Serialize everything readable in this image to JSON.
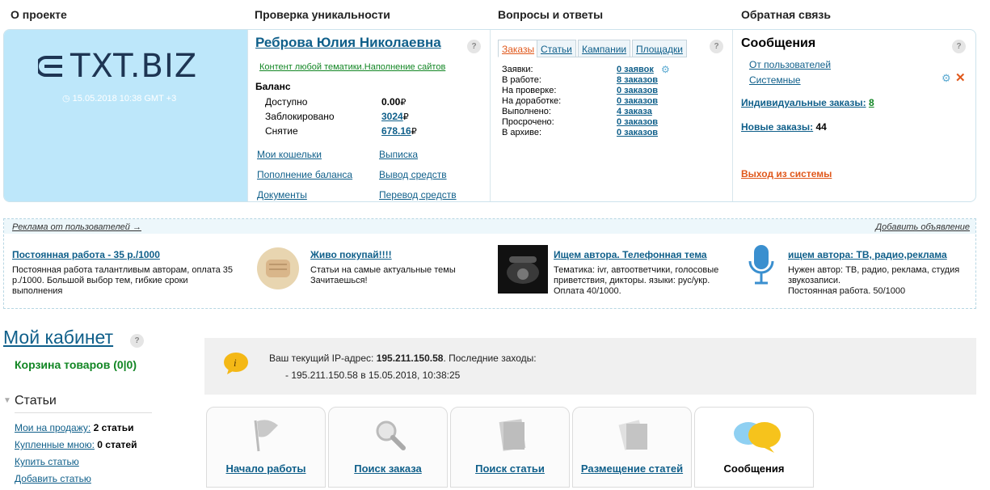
{
  "top_headings": [
    "О проекте",
    "Проверка уникальности",
    "Вопросы и ответы",
    "Обратная связь"
  ],
  "logo": {
    "text": "eTXT.BIZ",
    "datetime": "15.05.2018 10:38 GMT +3"
  },
  "profile": {
    "name": "Реброва Юлия Николаевна",
    "category": "Контент любой тематики.Наполнение сайтов",
    "balance_title": "Баланс",
    "balance": [
      {
        "label": "Доступно",
        "value": "0.00"
      },
      {
        "label": "Заблокировано",
        "value": "3024"
      },
      {
        "label": "Снятие",
        "value": "678.16"
      }
    ],
    "currency": "₽",
    "links": [
      "Мои кошельки",
      "Выписка",
      "Пополнение баланса",
      "Вывод средств",
      "Документы",
      "Перевод средств"
    ]
  },
  "orders": {
    "tabs": [
      "Заказы",
      "Статьи",
      "Кампании",
      "Площадки"
    ],
    "rows": [
      {
        "label": "Заявки:",
        "value": "0 заявок"
      },
      {
        "label": "В работе:",
        "value": "8 заказов"
      },
      {
        "label": "На проверке:",
        "value": "0 заказов"
      },
      {
        "label": "На доработке:",
        "value": "0 заказов"
      },
      {
        "label": "Выполнено:",
        "value": "4 заказа"
      },
      {
        "label": "Просрочено:",
        "value": "0 заказов"
      },
      {
        "label": "В архиве:",
        "value": "0 заказов"
      }
    ]
  },
  "messages": {
    "title": "Сообщения",
    "from_users": "От пользователей",
    "system": "Системные",
    "individual_label": "Индивидуальные заказы:",
    "individual_count": "8",
    "new_label": "Новые заказы:",
    "new_count": "44",
    "logout": "Выход из системы"
  },
  "ads": {
    "header_left": "Реклама от пользователей →",
    "header_right": "Добавить объявление",
    "items": [
      {
        "title": "Постоянная работа - 35 р./1000",
        "text": [
          "Постоянная работа талантливым авторам, оплата 35",
          "р./1000. Большой выбор тем, гибкие сроки",
          "выполнения"
        ]
      },
      {
        "title": "Живо покупай!!!!",
        "text": [
          "Статьи на самые актуальные темы",
          "Зачитаешься!"
        ]
      },
      {
        "title": "Ищем автора. Телефонная тема",
        "text": [
          "Тематика: ivr, автоответчики, голосовые",
          "приветствия, дикторы. языки: рус/укр.",
          "Оплата 40/1000."
        ]
      },
      {
        "title": "ищем автора: ТВ, радио,реклама",
        "text": [
          "Нужен автор: ТВ, радио, реклама, студия",
          "звукозаписи.",
          "Постоянная работа. 50/1000"
        ]
      }
    ]
  },
  "cabinet": {
    "title": "Мой кабинет",
    "cart": "Корзина товаров (0|0)",
    "section": "Статьи",
    "links": [
      {
        "label": "Мои на продажу:",
        "value": "2 статьи"
      },
      {
        "label": "Купленные мною:",
        "value": "0 статей"
      },
      {
        "label": "Купить статью",
        "value": ""
      },
      {
        "label": "Добавить статью",
        "value": ""
      }
    ]
  },
  "ipinfo": {
    "prefix": "Ваш текущий IP-адрес: ",
    "ip": "195.211.150.58",
    "suffix": ". Последние заходы:",
    "last": "- 195.211.150.58 в 15.05.2018, 10:38:25"
  },
  "cards": [
    "Начало работы",
    "Поиск заказа",
    "Поиск статьи",
    "Размещение статей",
    "Сообщения"
  ],
  "colors": {
    "link": "#0f5f8a",
    "green": "#128624",
    "orange": "#e0581b",
    "logo_bg": "#bde7fa"
  }
}
